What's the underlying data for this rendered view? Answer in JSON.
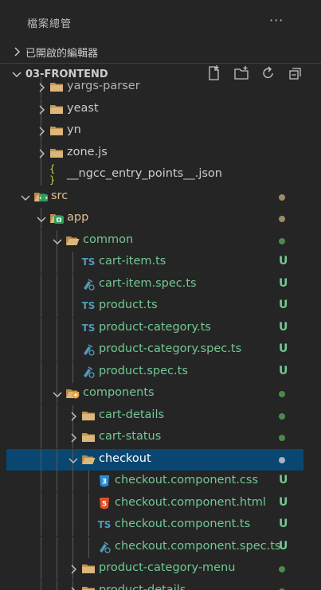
{
  "explorer": {
    "title": "檔案總管",
    "more_label": "···"
  },
  "sections": {
    "open_editors": {
      "label": "已開啟的編輯器"
    },
    "project": {
      "label": "03-FRONTEND",
      "toolbar": [
        "new-file-icon",
        "new-folder-icon",
        "refresh-icon",
        "collapse-all-icon"
      ]
    }
  },
  "colors": {
    "modified": "#e2c08d",
    "untracked": "#73c991",
    "dot_gray": "#8c8c8c",
    "dot_green": "#4b8a4f",
    "dot_brown": "#9e8a6a",
    "selected_bg": "#094771"
  },
  "tree": [
    {
      "label": "yargs-parser",
      "depth": 1,
      "kind": "folder",
      "state": "collapsed",
      "color": "#b2b2b2",
      "status": ""
    },
    {
      "label": "yeast",
      "depth": 1,
      "kind": "folder",
      "state": "collapsed",
      "color": "#cccccc",
      "status": ""
    },
    {
      "label": "yn",
      "depth": 1,
      "kind": "folder",
      "state": "collapsed",
      "color": "#cccccc",
      "status": ""
    },
    {
      "label": "zone.js",
      "depth": 1,
      "kind": "folder",
      "state": "collapsed",
      "color": "#cccccc",
      "status": ""
    },
    {
      "label": "__ngcc_entry_points__.json",
      "depth": 1,
      "kind": "json",
      "state": "",
      "color": "#cccccc",
      "status": ""
    },
    {
      "label": "src",
      "depth": 0,
      "kind": "src-folder",
      "state": "open",
      "color": "#e2c08d",
      "status": "dot-brown"
    },
    {
      "label": "app",
      "depth": 1,
      "kind": "app-folder",
      "state": "open",
      "color": "#e2c08d",
      "status": "dot-brown"
    },
    {
      "label": "common",
      "depth": 2,
      "kind": "folder",
      "state": "open",
      "color": "#73c991",
      "status": "dot-green"
    },
    {
      "label": "cart-item.ts",
      "depth": 3,
      "kind": "ts",
      "state": "",
      "color": "#73c991",
      "status": "U"
    },
    {
      "label": "cart-item.spec.ts",
      "depth": 3,
      "kind": "spec",
      "state": "",
      "color": "#73c991",
      "status": "U"
    },
    {
      "label": "product.ts",
      "depth": 3,
      "kind": "ts",
      "state": "",
      "color": "#73c991",
      "status": "U"
    },
    {
      "label": "product-category.ts",
      "depth": 3,
      "kind": "ts",
      "state": "",
      "color": "#73c991",
      "status": "U"
    },
    {
      "label": "product-category.spec.ts",
      "depth": 3,
      "kind": "spec",
      "state": "",
      "color": "#73c991",
      "status": "U"
    },
    {
      "label": "product.spec.ts",
      "depth": 3,
      "kind": "spec",
      "state": "",
      "color": "#73c991",
      "status": "U"
    },
    {
      "label": "components",
      "depth": 2,
      "kind": "components-folder",
      "state": "open",
      "color": "#73c991",
      "status": "dot-green"
    },
    {
      "label": "cart-details",
      "depth": 3,
      "kind": "folder",
      "state": "collapsed",
      "color": "#73c991",
      "status": "dot-green"
    },
    {
      "label": "cart-status",
      "depth": 3,
      "kind": "folder",
      "state": "collapsed",
      "color": "#73c991",
      "status": "dot-green"
    },
    {
      "label": "checkout",
      "depth": 3,
      "kind": "folder",
      "state": "open",
      "color": "#ffffff",
      "status": "dot-gray",
      "selected": true
    },
    {
      "label": "checkout.component.css",
      "depth": 4,
      "kind": "css",
      "state": "",
      "color": "#73c991",
      "status": "U"
    },
    {
      "label": "checkout.component.html",
      "depth": 4,
      "kind": "html",
      "state": "",
      "color": "#73c991",
      "status": "U"
    },
    {
      "label": "checkout.component.ts",
      "depth": 4,
      "kind": "ts",
      "state": "",
      "color": "#73c991",
      "status": "U"
    },
    {
      "label": "checkout.component.spec.ts",
      "depth": 4,
      "kind": "spec",
      "state": "",
      "color": "#73c991",
      "status": "U"
    },
    {
      "label": "product-category-menu",
      "depth": 3,
      "kind": "folder",
      "state": "collapsed",
      "color": "#73c991",
      "status": "dot-green"
    },
    {
      "label": "product-details",
      "depth": 3,
      "kind": "folder",
      "state": "collapsed",
      "color": "#73c991",
      "status": "dot-green"
    }
  ]
}
